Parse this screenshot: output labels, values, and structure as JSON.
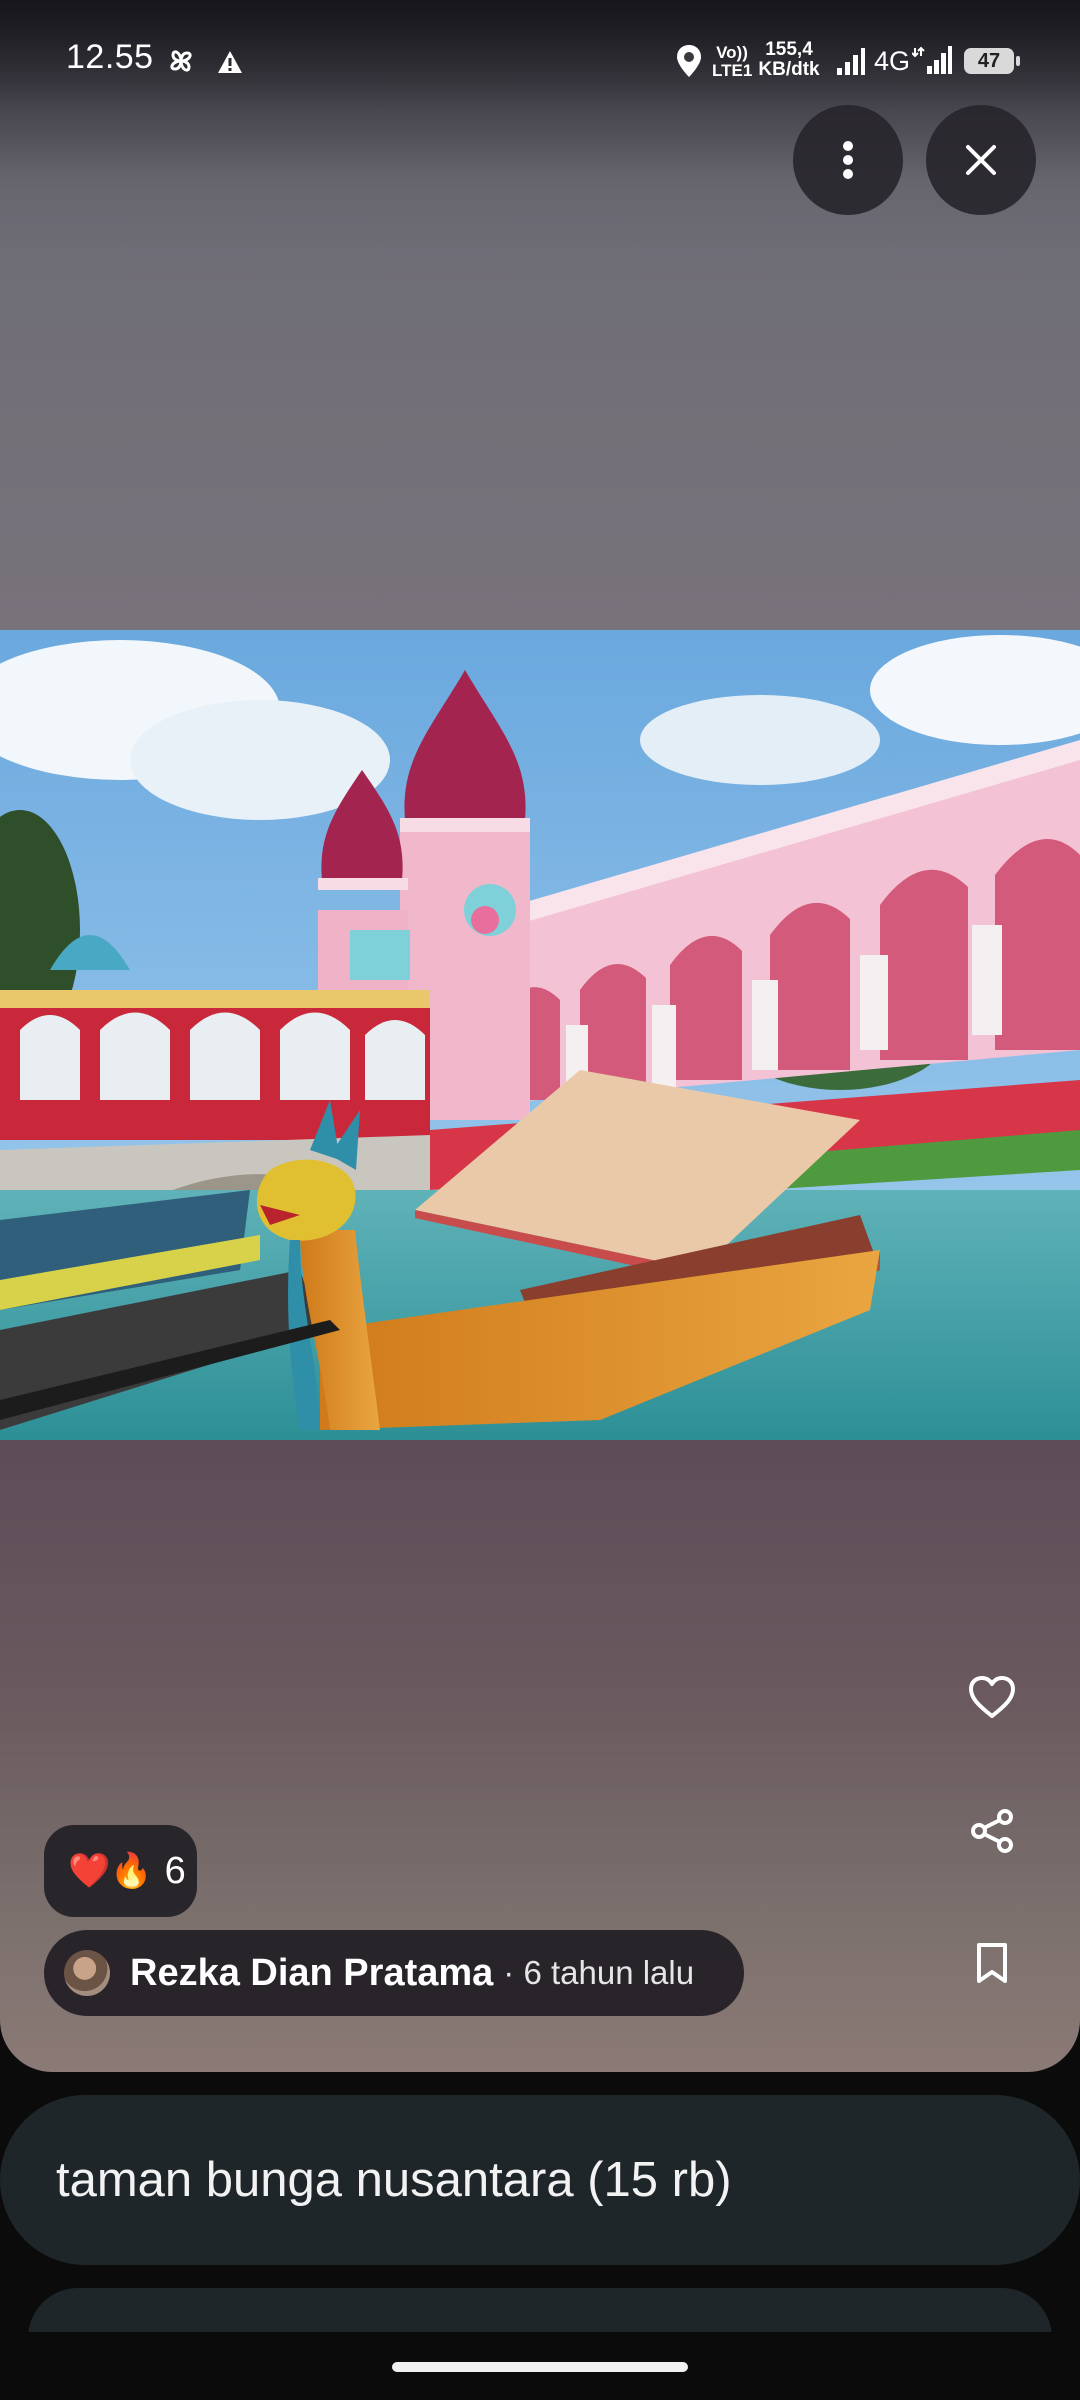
{
  "status_bar": {
    "time": "12.55",
    "net_top": "Vo))",
    "net_bottom": "LTE1",
    "speed_value": "155,4",
    "speed_unit": "KB/dtk",
    "network_type": "4G",
    "battery": "47"
  },
  "top_actions": {
    "more_icon": "more-vertical-icon",
    "close_icon": "close-icon"
  },
  "photo": {
    "subject": "theme park castle and dragon boat"
  },
  "side_actions": [
    {
      "icon": "heart-icon"
    },
    {
      "icon": "share-icon"
    },
    {
      "icon": "bookmark-icon"
    }
  ],
  "reactions": {
    "emojis": "❤️🔥",
    "count": "6"
  },
  "author": {
    "name": "Rezka Dian Pratama",
    "time": "· 6 tahun lalu"
  },
  "caption": {
    "text": "taman bunga nusantara (15 rb)"
  },
  "colors": {
    "chip_bg": "#1e1c22",
    "caption_bg": "#1f2629"
  }
}
